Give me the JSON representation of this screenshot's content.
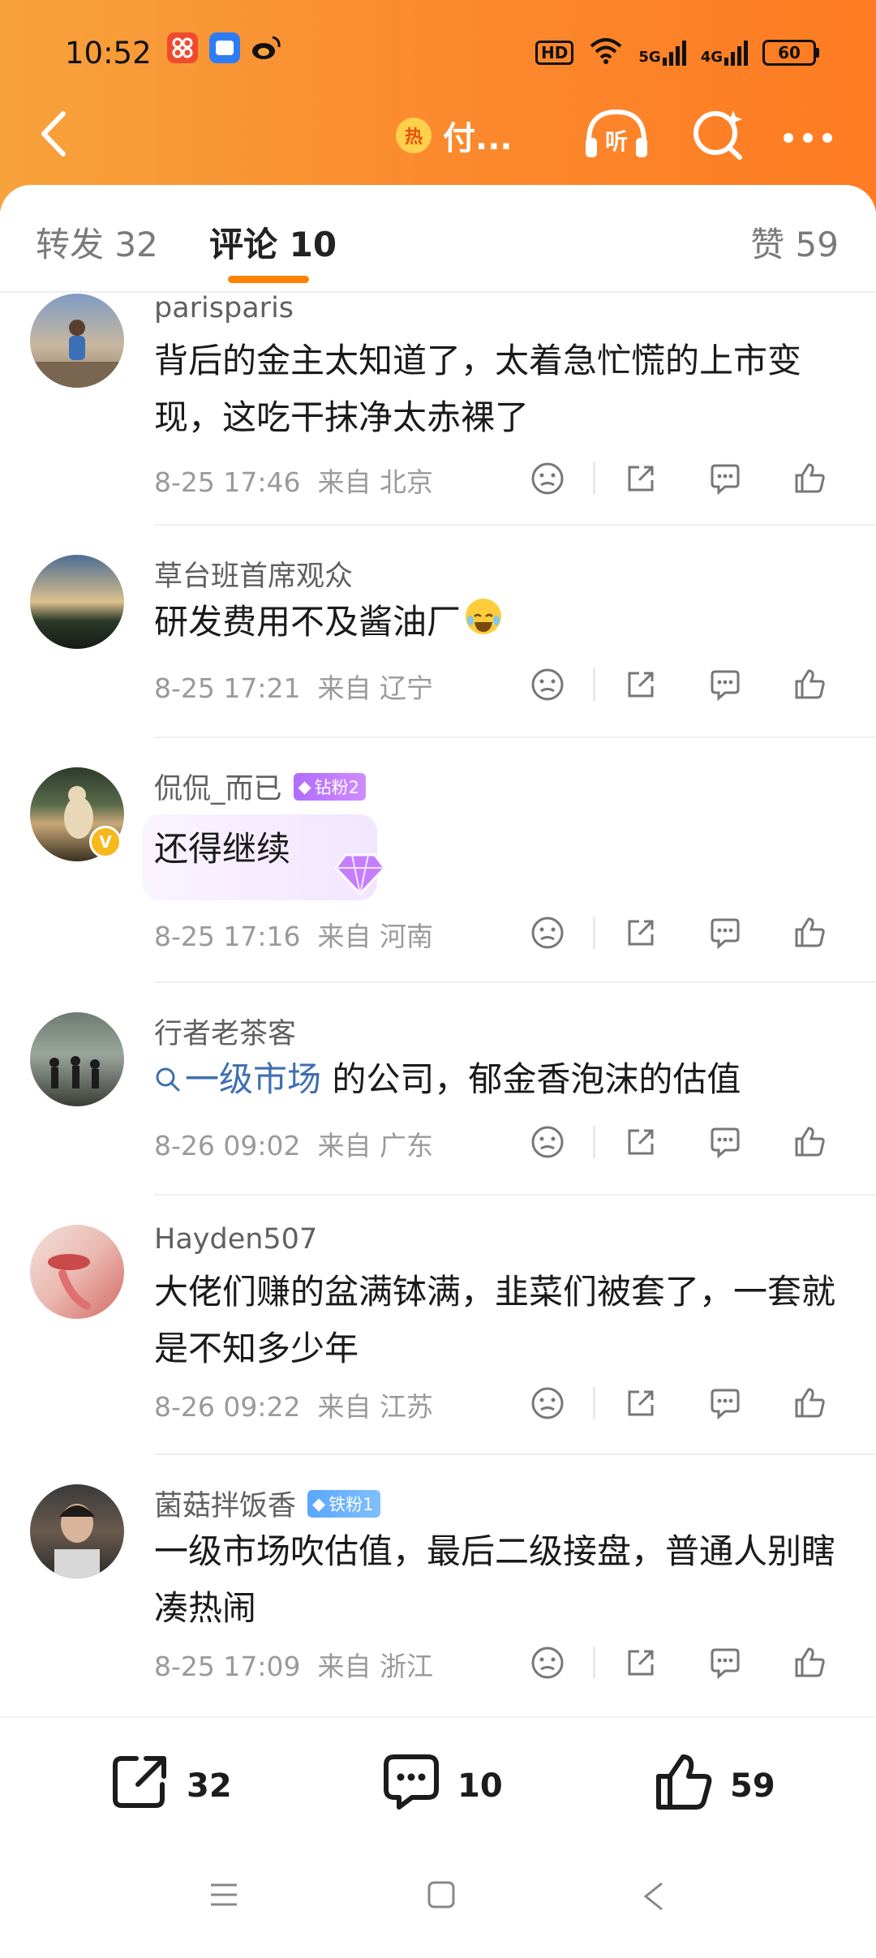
{
  "status_bar": {
    "time": "10:52",
    "hd": "HD",
    "net_5g": "5G",
    "net_4g": "4G",
    "battery": "60"
  },
  "nav": {
    "hot_badge": "热",
    "title": "付..."
  },
  "tabs": {
    "repost": "转发 32",
    "comments": "评论 10",
    "likes": "赞 59"
  },
  "comments": [
    {
      "user": "parisparis",
      "content": "背后的金主太知道了，太着急忙慌的上市变现，这吃干抹净太赤裸了",
      "time": "8-25 17:46",
      "source": "来自 北京"
    },
    {
      "user": "草台班首席观众",
      "content": "研发费用不及酱油厂",
      "time": "8-25 17:21",
      "source": "来自 辽宁"
    },
    {
      "user": "侃侃_而已",
      "badge": "钻粉2",
      "verified": "V",
      "content": "还得继续",
      "time": "8-25 17:16",
      "source": "来自 河南"
    },
    {
      "user": "行者老茶客",
      "topic": "一级市场",
      "content": " 的公司，郁金香泡沫的估值",
      "time": "8-26 09:02",
      "source": "来自 广东"
    },
    {
      "user": "Hayden507",
      "content": "大佬们赚的盆满钵满，韭菜们被套了，一套就是不知多少年",
      "time": "8-26 09:22",
      "source": "来自 江苏"
    },
    {
      "user": "菌菇拌饭香",
      "badge": "铁粉1",
      "content": "一级市场吹估值，最后二级接盘，普通人别瞎凑热闹",
      "time": "8-25 17:09",
      "source": "来自 浙江"
    }
  ],
  "bottom_bar": {
    "repost_count": "32",
    "comment_count": "10",
    "like_count": "59"
  },
  "colors": {
    "accent": "#ff8200",
    "header_gradient_start": "#f7a23c",
    "header_gradient_end": "#ff7b22",
    "topic_link": "#3f6fb2"
  }
}
